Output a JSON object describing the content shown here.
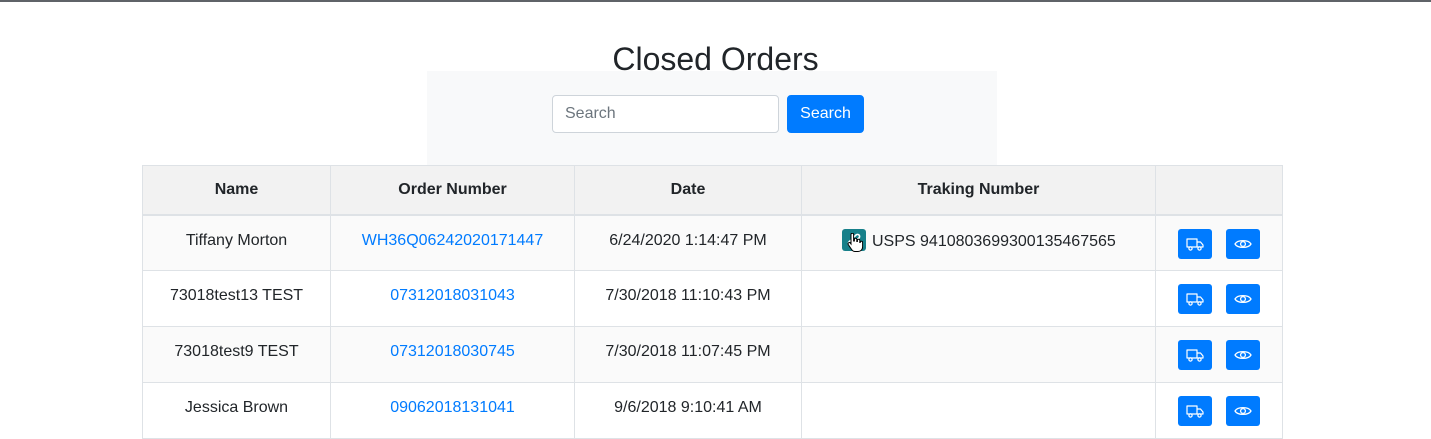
{
  "page": {
    "title": "Closed Orders"
  },
  "search": {
    "placeholder": "Search",
    "value": "",
    "button_label": "Search"
  },
  "table": {
    "headers": [
      "Name",
      "Order Number",
      "Date",
      "Traking Number",
      ""
    ],
    "rows": [
      {
        "name": "Tiffany Morton",
        "order_number": "WH36Q06242020171447",
        "date": "6/24/2020 1:14:47 PM",
        "tracking": "USPS 9410803699300135467565"
      },
      {
        "name": "73018test13 TEST",
        "order_number": "07312018031043",
        "date": "7/30/2018 11:10:43 PM",
        "tracking": ""
      },
      {
        "name": "73018test9 TEST",
        "order_number": "07312018030745",
        "date": "7/30/2018 11:07:45 PM",
        "tracking": ""
      },
      {
        "name": "Jessica Brown",
        "order_number": "09062018131041",
        "date": "9/6/2018 9:10:41 AM",
        "tracking": ""
      }
    ]
  },
  "icons": {
    "tracking_link": "link-icon",
    "cursor": "hand-pointer-icon",
    "ship_action": "truck-icon",
    "view_action": "eye-icon"
  },
  "colors": {
    "primary": "#007bff",
    "tracking_link_button": "#17808a",
    "text": "#212529"
  }
}
